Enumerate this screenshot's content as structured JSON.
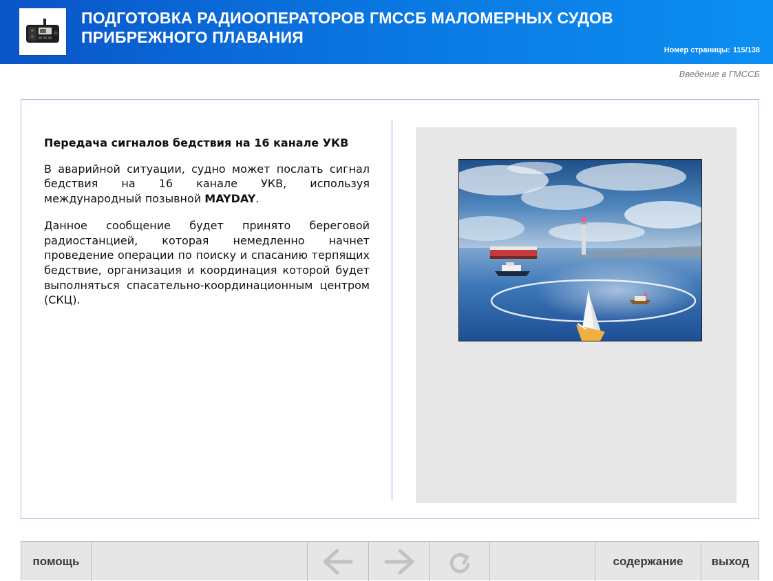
{
  "header": {
    "title_line1": "ПОДГОТОВКА РАДИООПЕРАТОРОВ ГМССБ МАЛОМЕРНЫХ СУДОВ",
    "title_line2": "ПРИБРЕЖНОГО ПЛАВАНИЯ",
    "page_label": "Номер страницы:",
    "page_value": "115/138",
    "logo_icon": "vhf-radio-icon"
  },
  "section": "Введение в ГМССБ",
  "content": {
    "heading": "Передача сигналов бедствия на 16 канале УКВ",
    "p1_before": "В аварийной ситуации, судно может послать сигнал бедствия на 16 канале УКВ, используя международный позывной ",
    "p1_bold": "MAYDAY",
    "p1_after": ".",
    "p2": "Данное сообщение будет принято береговой радиостанцией, которая немедленно начнет проведение операции по поиску и спасанию терпящих бедствие, организация и координация которой будет выполняться спасательно-координационным центром (СКЦ)."
  },
  "nav": {
    "help": "помощь",
    "back_icon": "arrow-left-icon",
    "forward_icon": "arrow-right-icon",
    "replay_icon": "replay-icon",
    "contents": "содержание",
    "exit": "выход"
  },
  "colors": {
    "header_gradient_start": "#0a55c8",
    "header_gradient_end": "#0c8ff2",
    "frame_border": "#b4b8e6",
    "panel_bg": "#e7e7e7",
    "nav_bg": "#e6e6e6",
    "nav_icon_disabled": "#c2c2c2"
  }
}
